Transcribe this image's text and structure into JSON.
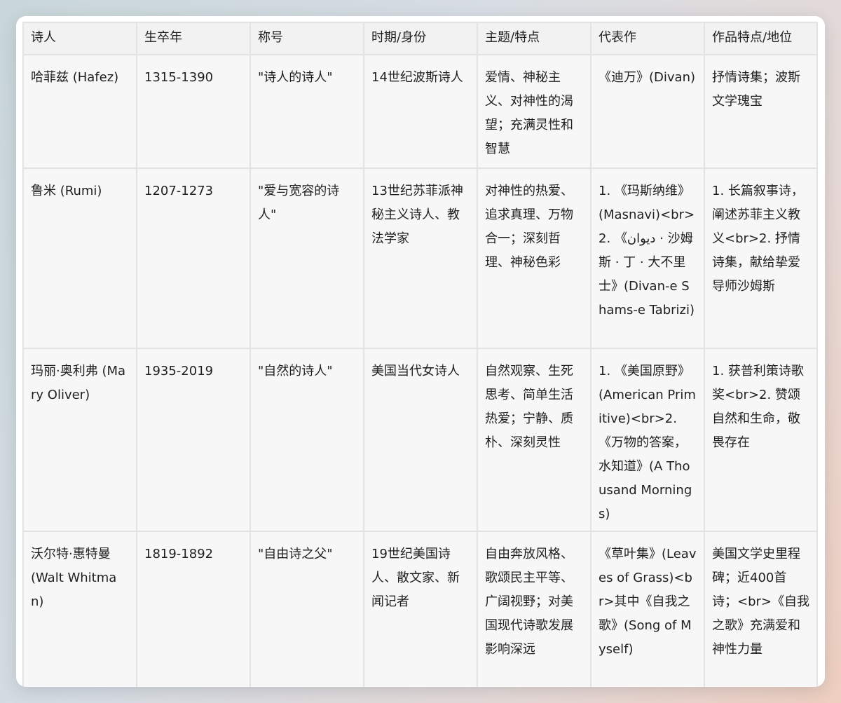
{
  "table": {
    "headers": [
      "诗人",
      "生卒年",
      "称号",
      "时期/身份",
      "主题/特点",
      "代表作",
      "作品特点/地位"
    ],
    "rows": [
      [
        "哈菲兹 (Hafez)",
        "1315-1390",
        "\"诗人的诗人\"",
        "14世纪波斯诗人",
        "爱情、神秘主义、对神性的渴望；充满灵性和智慧",
        "《迪万》(Divan)",
        "抒情诗集；波斯文学瑰宝"
      ],
      [
        "鲁米 (Rumi)",
        "1207-1273",
        "\"爱与宽容的诗人\"",
        "13世纪苏菲派神秘主义诗人、教法学家",
        "对神性的热爱、追求真理、万物合一；深刻哲理、神秘色彩",
        "1. 《玛斯纳维》(Masnavi)<br>2. 《ديوان · 沙姆斯 · 丁 · 大不里士》(Divan-e Shams-e Tabrizi)",
        "1. 长篇叙事诗，阐述苏菲主义教义<br>2. 抒情诗集，献给挚爱导师沙姆斯"
      ],
      [
        "玛丽·奥利弗 (Mary Oliver)",
        "1935-2019",
        "\"自然的诗人\"",
        "美国当代女诗人",
        "自然观察、生死思考、简单生活热爱；宁静、质朴、深刻灵性",
        "1. 《美国原野》(American Primitive)<br>2. 《万物的答案，水知道》(A Thousand Mornings)",
        "1. 获普利策诗歌奖<br>2. 赞颂自然和生命，敬畏存在"
      ],
      [
        "沃尔特·惠特曼 (Walt Whitman)",
        "1819-1892",
        "\"自由诗之父\"",
        "19世纪美国诗人、散文家、新闻记者",
        "自由奔放风格、歌颂民主平等、广阔视野；对美国现代诗歌发展影响深远",
        "《草叶集》(Leaves of Grass)<br>其中《自我之歌》(Song of Myself)",
        "美国文学史里程碑；近400首诗；<br>《自我之歌》充满爱和神性力量"
      ]
    ]
  }
}
